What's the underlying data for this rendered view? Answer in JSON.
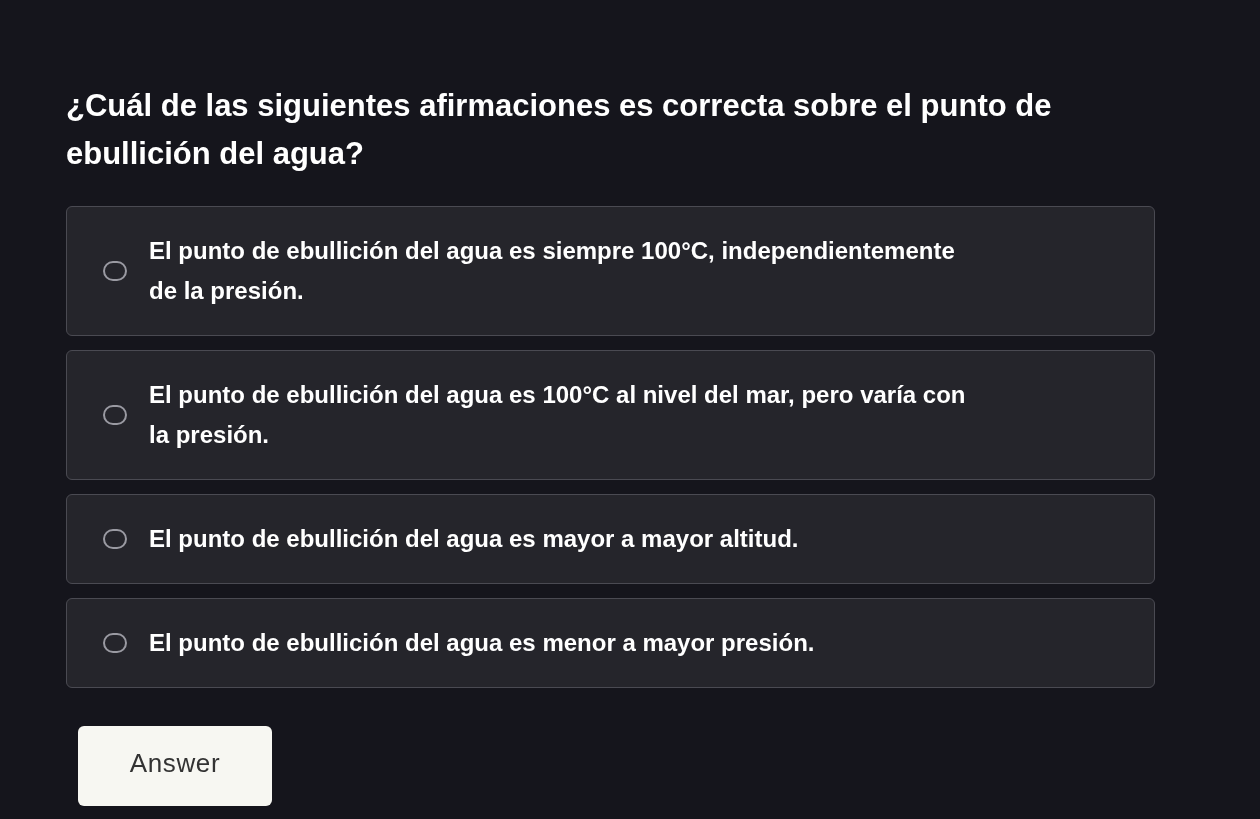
{
  "question": "¿Cuál de las siguientes afirmaciones es correcta sobre el punto de ebullición del agua?",
  "options": [
    {
      "label": "El punto de ebullición del agua es siempre 100°C, independientemente de la presión.",
      "selected": false
    },
    {
      "label": "El punto de ebullición del agua es 100°C al nivel del mar, pero varía con la presión.",
      "selected": false
    },
    {
      "label": "El punto de ebullición del agua es mayor a mayor altitud.",
      "selected": false
    },
    {
      "label": "El punto de ebullición del agua es menor a mayor presión.",
      "selected": false
    }
  ],
  "submit_button": "Answer"
}
